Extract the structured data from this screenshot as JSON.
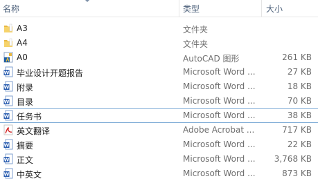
{
  "columns": {
    "name": "名称",
    "type": "类型",
    "size": "大小"
  },
  "files": [
    {
      "name": "A3",
      "type": "文件夹",
      "size": "",
      "icon": "folder-icon"
    },
    {
      "name": "A4",
      "type": "文件夹",
      "size": "",
      "icon": "folder-icon"
    },
    {
      "name": "A0",
      "type": "AutoCAD 图形",
      "size": "261 KB",
      "icon": "autocad-file-icon"
    },
    {
      "name": "毕业设计开题报告",
      "type": "Microsoft Word ...",
      "size": "27 KB",
      "icon": "word-document-icon"
    },
    {
      "name": "附录",
      "type": "Microsoft Word ...",
      "size": "18 KB",
      "icon": "word-document-icon"
    },
    {
      "name": "目录",
      "type": "Microsoft Word ...",
      "size": "70 KB",
      "icon": "word-document-icon"
    },
    {
      "name": "任务书",
      "type": "Microsoft Word ...",
      "size": "38 KB",
      "icon": "word-document-icon",
      "selected": true
    },
    {
      "name": "英文翻译",
      "type": "Adobe Acrobat ...",
      "size": "717 KB",
      "icon": "pdf-file-icon"
    },
    {
      "name": "摘要",
      "type": "Microsoft Word ...",
      "size": "22 KB",
      "icon": "word-document-icon"
    },
    {
      "name": "正文",
      "type": "Microsoft Word ...",
      "size": "3,768 KB",
      "icon": "word-document-icon"
    },
    {
      "name": "中英文",
      "type": "Microsoft Word ...",
      "size": "873 KB",
      "icon": "word-document-icon"
    }
  ]
}
